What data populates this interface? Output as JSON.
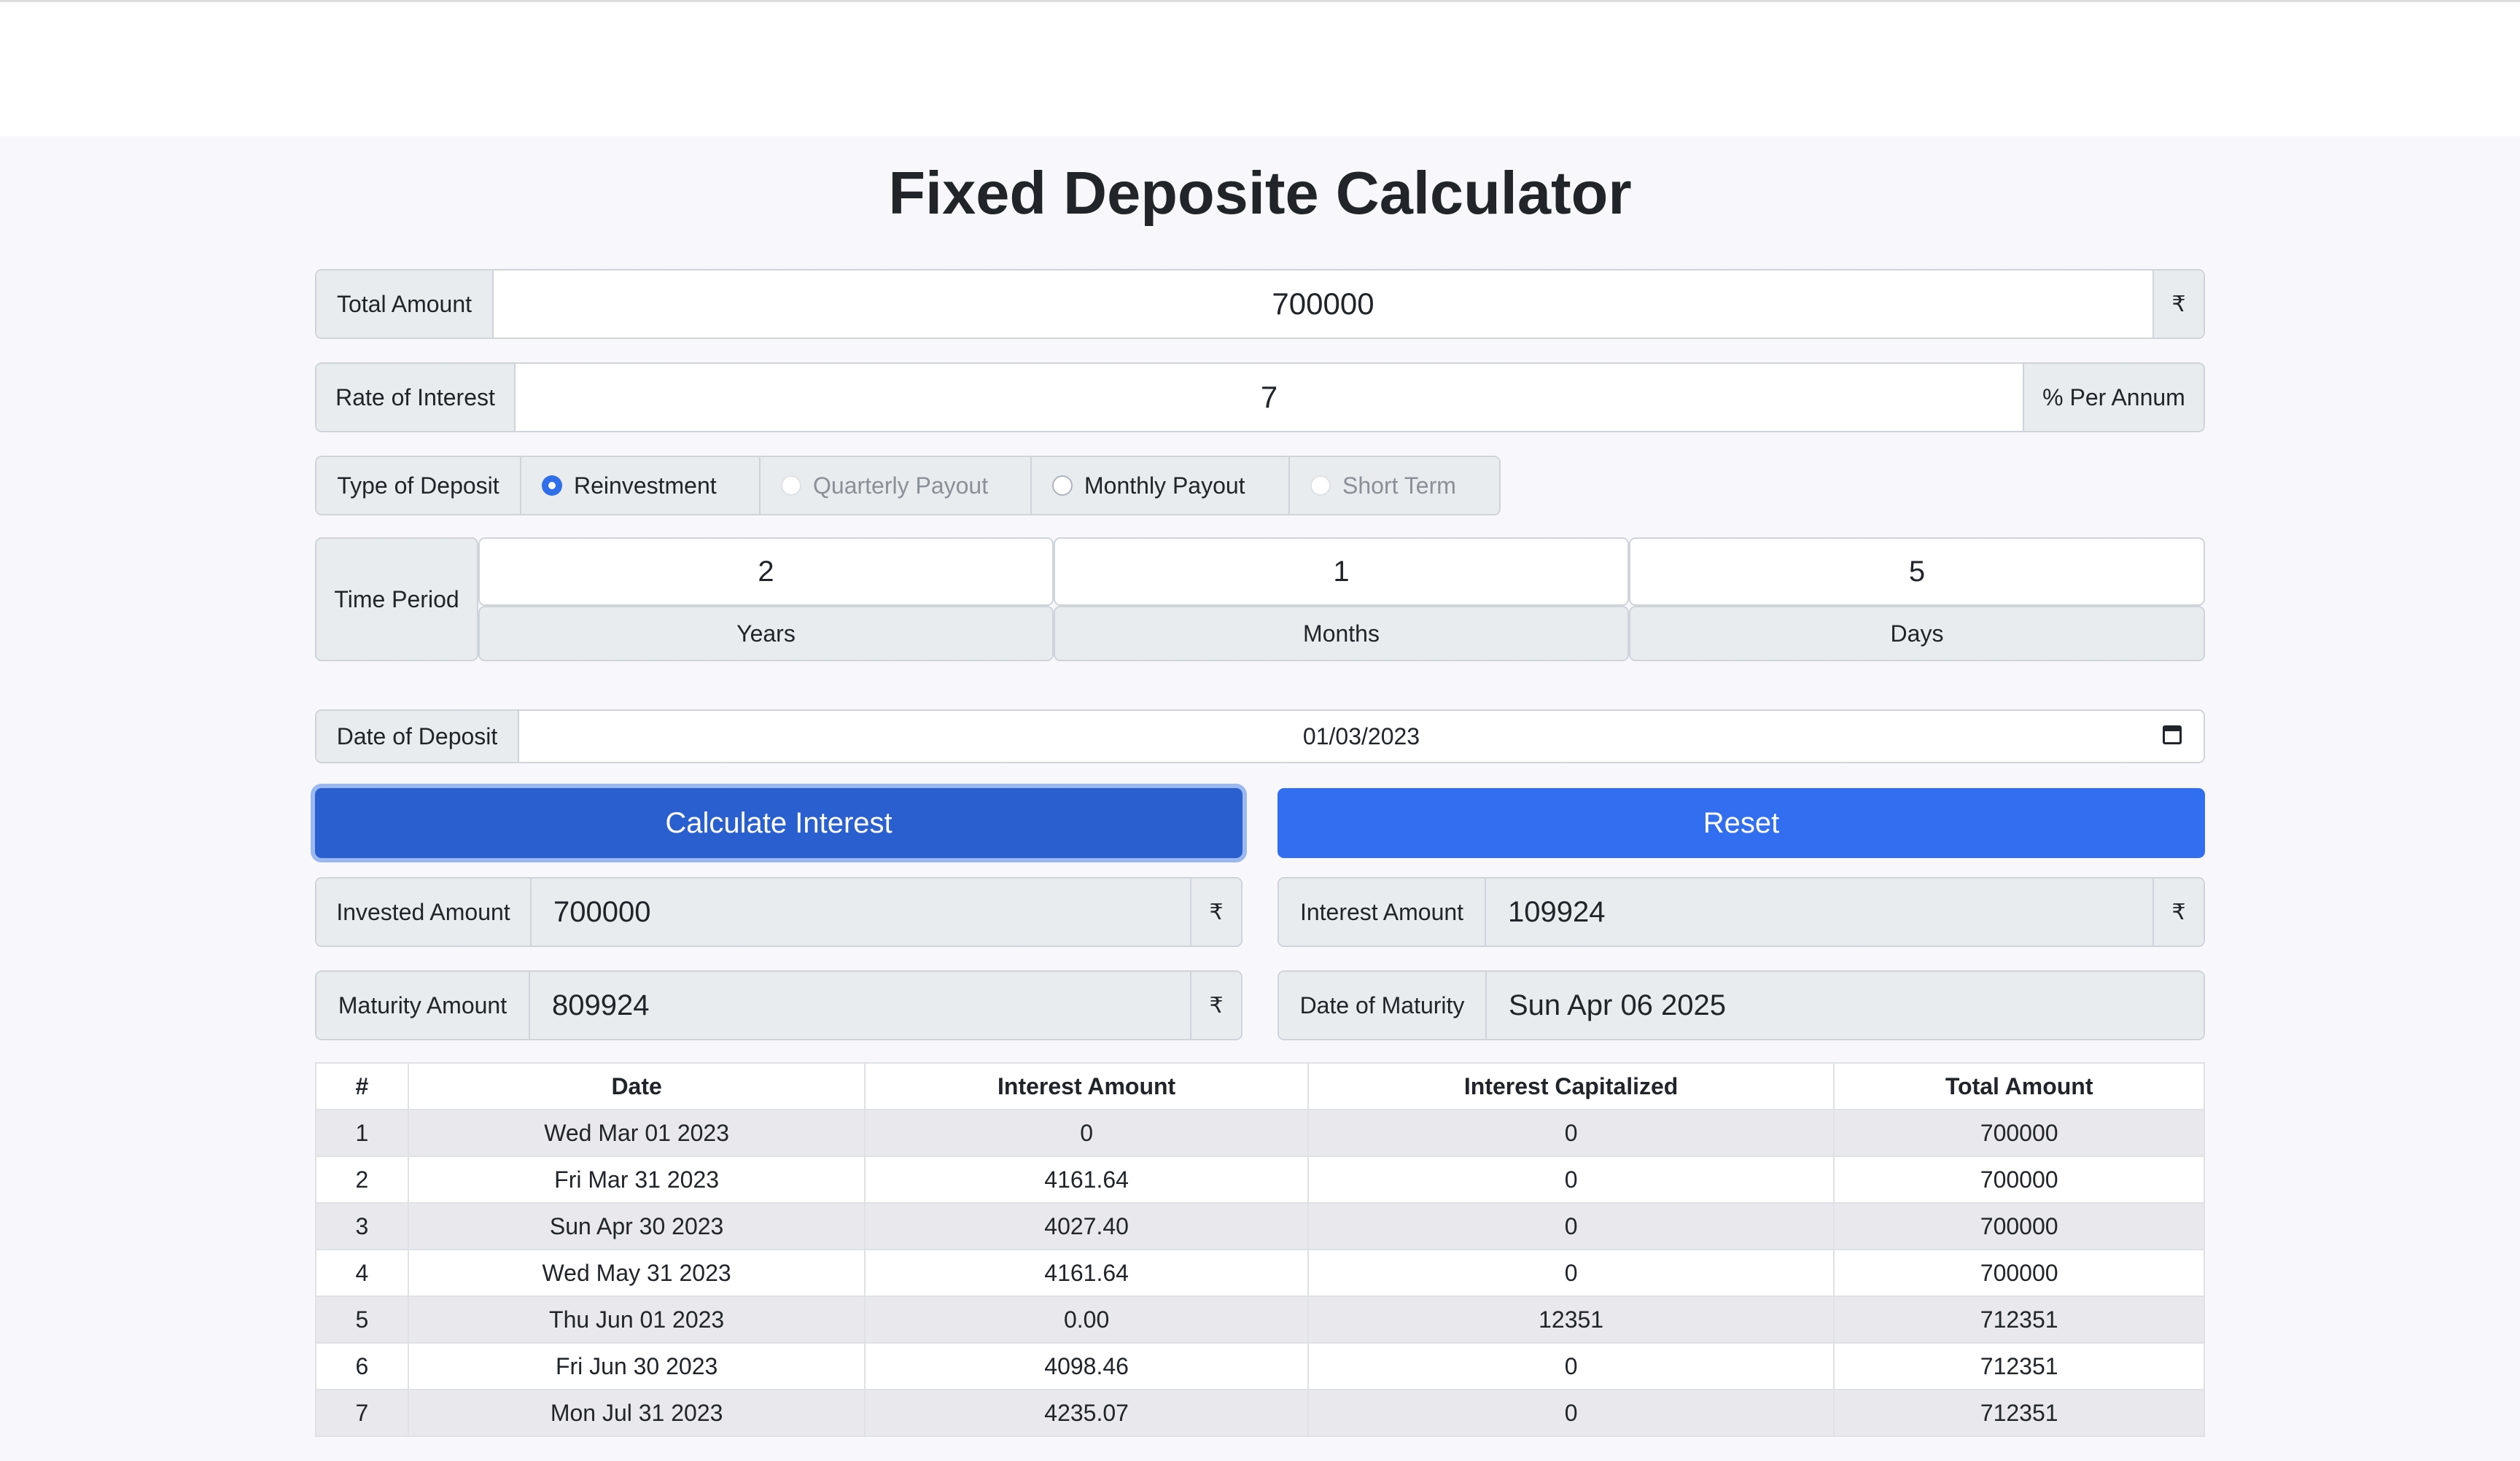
{
  "title": "Fixed Deposite Calculator",
  "total_amount": {
    "label": "Total Amount",
    "value": "700000",
    "suffix": "₹"
  },
  "rate_of_interest": {
    "label": "Rate of Interest",
    "value": "7",
    "suffix": "% Per Annum"
  },
  "deposit_type": {
    "label": "Type of Deposit",
    "options": [
      {
        "label": "Reinvestment",
        "checked": true,
        "disabled": false
      },
      {
        "label": "Quarterly Payout",
        "checked": false,
        "disabled": true
      },
      {
        "label": "Monthly Payout",
        "checked": false,
        "disabled": false
      },
      {
        "label": "Short Term",
        "checked": false,
        "disabled": true
      }
    ]
  },
  "time_period": {
    "label": "Time Period",
    "years": {
      "value": "2",
      "label": "Years"
    },
    "months": {
      "value": "1",
      "label": "Months"
    },
    "days": {
      "value": "5",
      "label": "Days"
    }
  },
  "date_of_deposit": {
    "label": "Date of Deposit",
    "value": "01/03/2023",
    "icon": "calendar-icon"
  },
  "buttons": {
    "calculate": "Calculate Interest",
    "reset": "Reset"
  },
  "results": {
    "invested": {
      "label": "Invested Amount",
      "value": "700000",
      "suffix": "₹"
    },
    "interest": {
      "label": "Interest Amount",
      "value": "109924",
      "suffix": "₹"
    },
    "maturity": {
      "label": "Maturity Amount",
      "value": "809924",
      "suffix": "₹"
    },
    "maturity_date": {
      "label": "Date of Maturity",
      "value": "Sun Apr 06 2025"
    }
  },
  "table": {
    "headers": [
      "#",
      "Date",
      "Interest Amount",
      "Interest Capitalized",
      "Total Amount"
    ],
    "rows": [
      [
        "1",
        "Wed Mar 01 2023",
        "0",
        "0",
        "700000"
      ],
      [
        "2",
        "Fri Mar 31 2023",
        "4161.64",
        "0",
        "700000"
      ],
      [
        "3",
        "Sun Apr 30 2023",
        "4027.40",
        "0",
        "700000"
      ],
      [
        "4",
        "Wed May 31 2023",
        "4161.64",
        "0",
        "700000"
      ],
      [
        "5",
        "Thu Jun 01 2023",
        "0.00",
        "12351",
        "712351"
      ],
      [
        "6",
        "Fri Jun 30 2023",
        "4098.46",
        "0",
        "712351"
      ],
      [
        "7",
        "Mon Jul 31 2023",
        "4235.07",
        "0",
        "712351"
      ]
    ]
  }
}
